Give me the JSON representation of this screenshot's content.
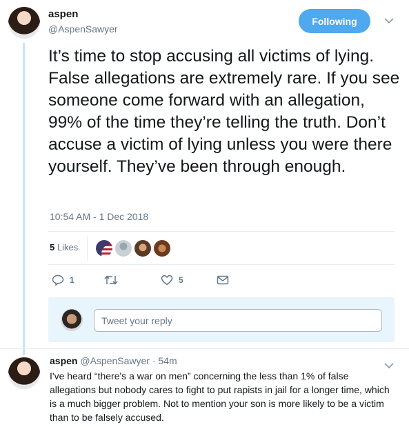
{
  "tweet": {
    "author_name": "aspen",
    "author_handle": "@AspenSawyer",
    "follow_label": "Following",
    "text": "It’s time to stop accusing all victims of lying. False allegations are extremely rare. If you see someone come forward with an allegation, 99% of the time they’re telling the truth. Don’t accuse a victim of lying unless you were there yourself. They’ve been through enough.",
    "timestamp": "10:54 AM - 1 Dec 2018",
    "likes_count": "5",
    "likes_label": "Likes",
    "actions": {
      "reply_count": "1",
      "retweet_count": "",
      "like_count": "5"
    }
  },
  "reply_box": {
    "placeholder": "Tweet your reply"
  },
  "reply": {
    "author_name": "aspen",
    "author_handle": "@AspenSawyer",
    "time": "· 54m",
    "text": "I've heard “there's a war on men” concerning the less than 1% of false allegations but nobody cares to fight to put rapists in jail for a longer time, which is a much bigger problem. Not to mention your son is more likely to be a victim than to be falsely accused."
  },
  "colors": {
    "accent": "#4fa9ee",
    "thread_line": "#c4e4fb",
    "muted": "#657786",
    "reply_box_bg": "#e8f5fd"
  },
  "icons": [
    "chevron-down-icon",
    "reply-icon",
    "retweet-icon",
    "heart-icon",
    "mail-icon"
  ]
}
